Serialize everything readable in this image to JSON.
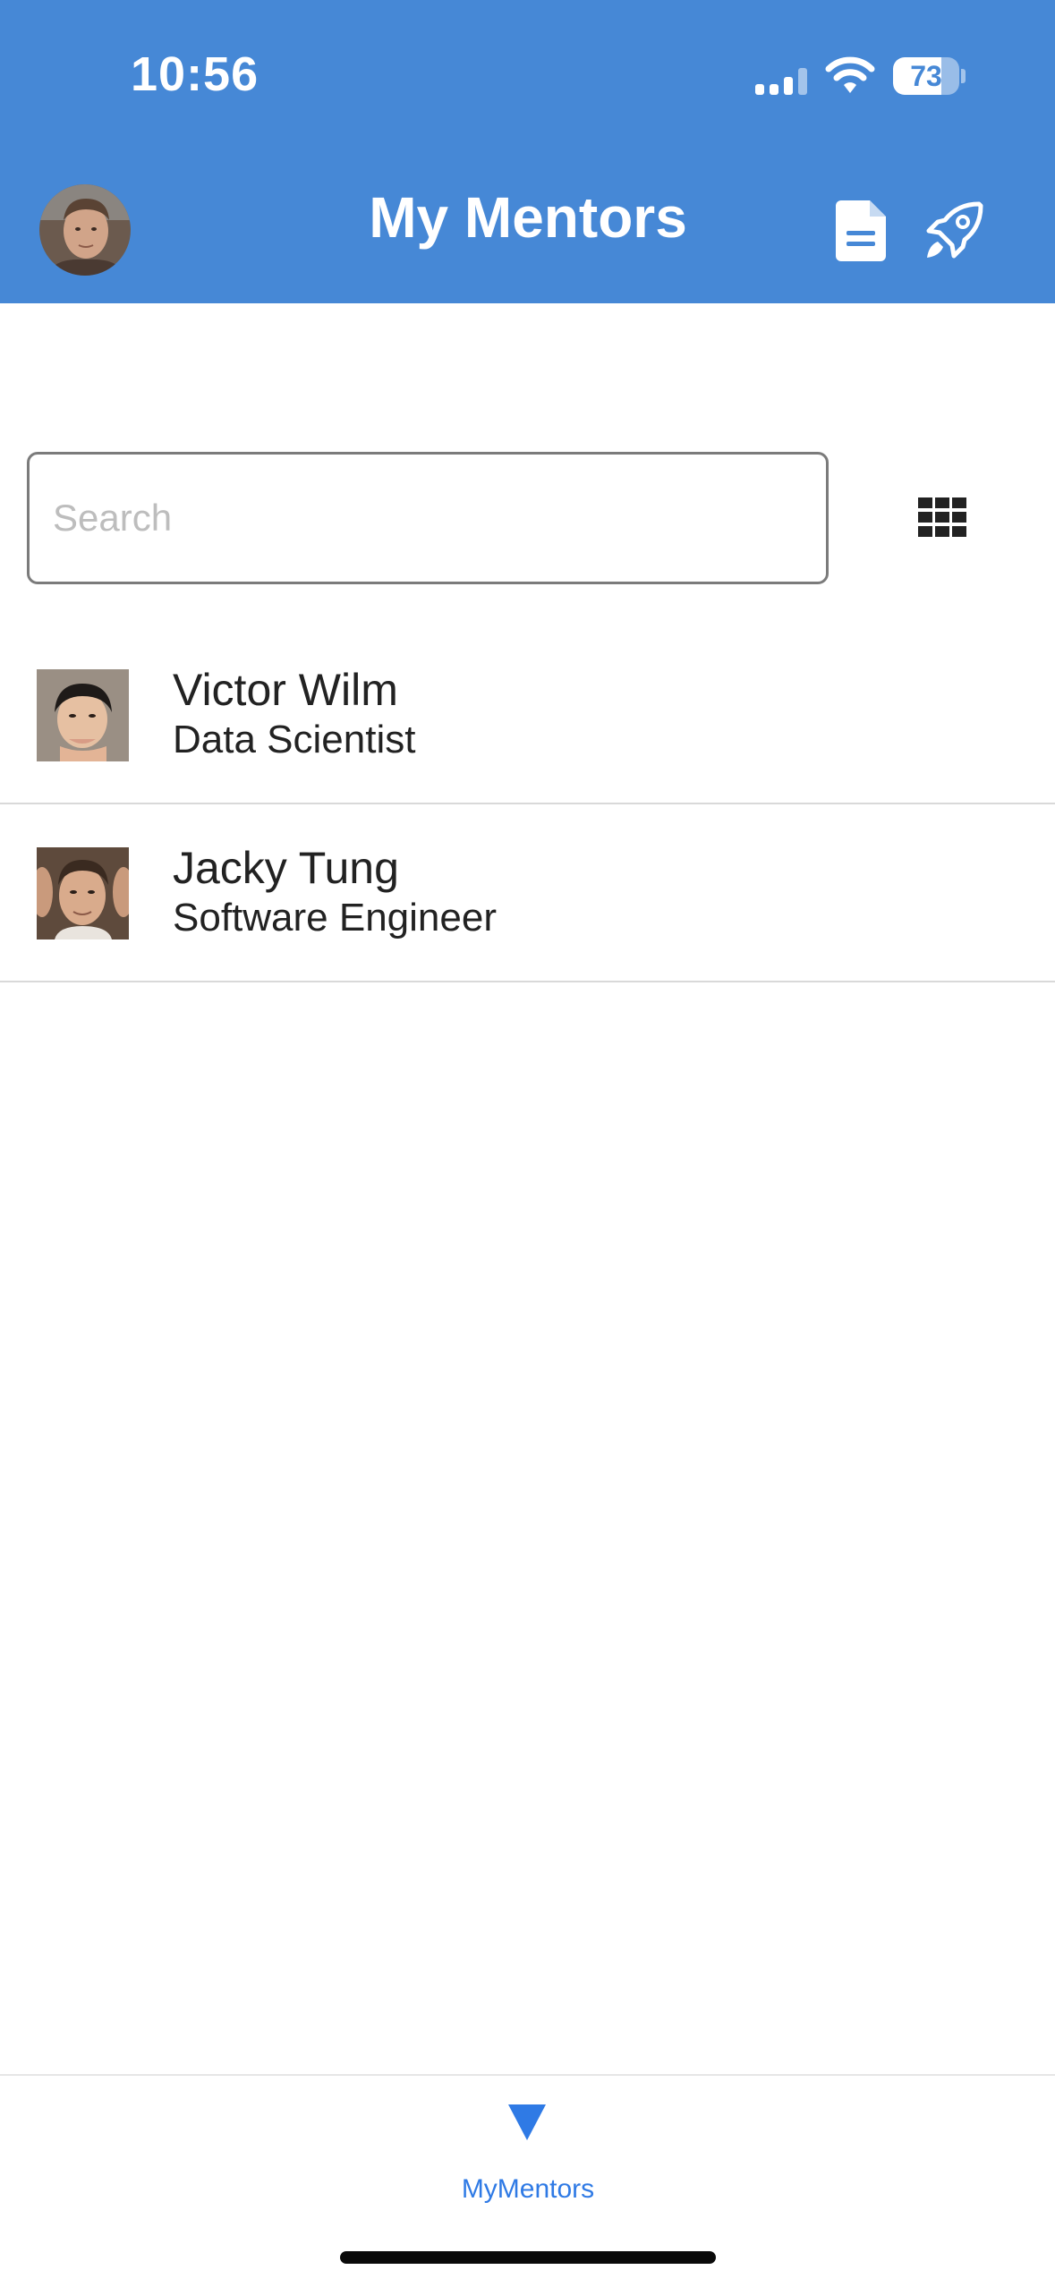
{
  "status_bar": {
    "time": "10:56",
    "battery": "73",
    "battery_level": 0.73
  },
  "header": {
    "title": "My Mentors",
    "avatar_icon": "user-avatar",
    "doc_icon": "document-icon",
    "rocket_icon": "rocket-icon"
  },
  "search": {
    "placeholder": "Search",
    "value": ""
  },
  "view_toggle": {
    "icon": "grid-view-icon"
  },
  "mentors": [
    {
      "name": "Victor Wilm",
      "role": "Data Scientist"
    },
    {
      "name": "Jacky Tung",
      "role": "Software Engineer"
    }
  ],
  "tabbar": {
    "items": [
      {
        "label": "MyMentors",
        "icon": "filter-triangle-icon",
        "active": true
      }
    ]
  },
  "colors": {
    "header_bg": "#4688d6",
    "tab_active": "#2f7ae5",
    "text": "#222222",
    "divider": "#d9d9d9"
  }
}
